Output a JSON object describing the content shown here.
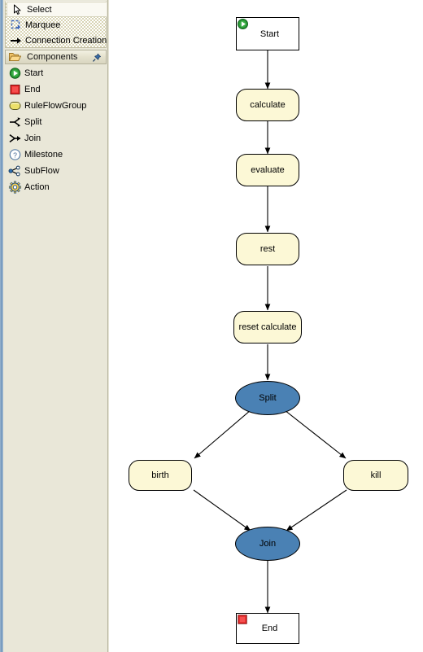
{
  "palette": {
    "tools": [
      {
        "label": "Select",
        "icon": "cursor-arrow-icon",
        "selected": true
      },
      {
        "label": "Marquee",
        "icon": "marquee-dashed-box-icon",
        "selected": false
      },
      {
        "label": "Connection Creation",
        "icon": "arrow-right-icon",
        "selected": false
      }
    ],
    "drawer": {
      "label": "Components",
      "icon": "open-folder-icon",
      "pin_icon": "pin-icon"
    },
    "components": [
      {
        "label": "Start",
        "icon": "green-play-circle-icon"
      },
      {
        "label": "End",
        "icon": "red-square-icon"
      },
      {
        "label": "RuleFlowGroup",
        "icon": "yellow-rounded-rect-icon"
      },
      {
        "label": "Split",
        "icon": "split-branch-icon"
      },
      {
        "label": "Join",
        "icon": "join-merge-icon"
      },
      {
        "label": "Milestone",
        "icon": "question-circle-icon"
      },
      {
        "label": "SubFlow",
        "icon": "subflow-nodes-icon"
      },
      {
        "label": "Action",
        "icon": "gear-icon"
      }
    ]
  },
  "canvas": {
    "nodes": {
      "start": {
        "label": "Start",
        "icon": "green-play-circle-icon",
        "type": "terminal"
      },
      "calculate": {
        "label": "calculate",
        "type": "task"
      },
      "evaluate": {
        "label": "evaluate",
        "type": "task"
      },
      "rest": {
        "label": "rest",
        "type": "task"
      },
      "reset": {
        "label": "reset calculate",
        "type": "task"
      },
      "split": {
        "label": "Split",
        "type": "gateway"
      },
      "birth": {
        "label": "birth",
        "type": "task"
      },
      "kill": {
        "label": "kill",
        "type": "task"
      },
      "join": {
        "label": "Join",
        "type": "gateway"
      },
      "end": {
        "label": "End",
        "icon": "red-square-icon",
        "type": "terminal"
      }
    }
  },
  "colors": {
    "task_fill": "#fcf8d6",
    "gateway_fill": "#4a81b4",
    "terminal_fill": "#ffffff",
    "palette_bg": "#e9e7d8",
    "start_icon": "#1f9e2e",
    "end_icon": "#e02222",
    "canvas_bg": "#ffffff",
    "connector": "#000000"
  }
}
